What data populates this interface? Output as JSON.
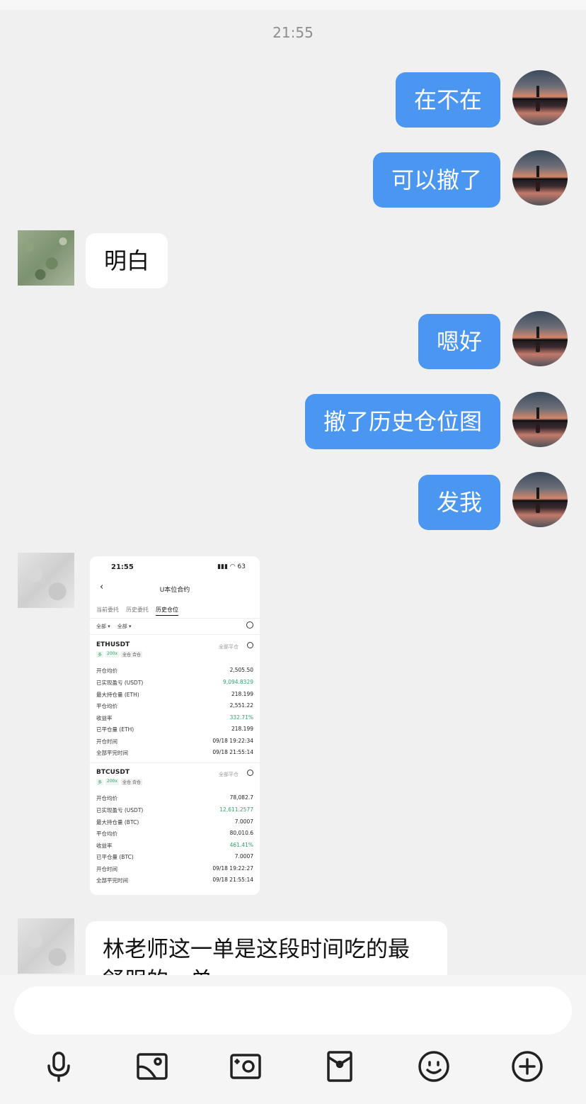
{
  "timestamp": "21:55",
  "messages": {
    "m1": "在不在",
    "m2": "可以撤了",
    "m3": "明白",
    "m4": "嗯好",
    "m5": "撤了历史仓位图",
    "m6": "发我",
    "m7_line1": "林老师这一单是这段时间吃的最",
    "m7_line2": "舒服的一单"
  },
  "screenshot": {
    "status_time": "21:55",
    "status_icons": "▮▮▮ ◠ 63",
    "title": "U本位合约",
    "tabs": [
      "当前委托",
      "历史委托",
      "历史仓位"
    ],
    "filters": [
      "全部 ▾",
      "全部 ▾"
    ],
    "positions": [
      {
        "symbol": "ETHUSDT",
        "status": "全部平仓",
        "tags": [
          "多",
          "200x",
          "全仓 合仓"
        ],
        "rows": [
          {
            "label": "开仓均价",
            "value": "2,505.50",
            "green": false
          },
          {
            "label": "已实现盈亏 (USDT)",
            "value": "9,094.8329",
            "green": true
          },
          {
            "label": "最大持仓量 (ETH)",
            "value": "218.199",
            "green": false
          },
          {
            "label": "平仓均价",
            "value": "2,551.22",
            "green": false
          },
          {
            "label": "收益率",
            "value": "332.71%",
            "green": true
          },
          {
            "label": "已平仓量 (ETH)",
            "value": "218.199",
            "green": false
          },
          {
            "label": "开仓时间",
            "value": "09/18 19:22:34",
            "green": false
          },
          {
            "label": "全部平完时间",
            "value": "09/18 21:55:14",
            "green": false
          }
        ]
      },
      {
        "symbol": "BTCUSDT",
        "status": "全部平仓",
        "tags": [
          "多",
          "200x",
          "全仓 合仓"
        ],
        "rows": [
          {
            "label": "开仓均价",
            "value": "78,082.7",
            "green": false
          },
          {
            "label": "已实现盈亏 (USDT)",
            "value": "12,611.2577",
            "green": true
          },
          {
            "label": "最大持仓量 (BTC)",
            "value": "7.0007",
            "green": false
          },
          {
            "label": "平仓均价",
            "value": "80,010.6",
            "green": false
          },
          {
            "label": "收益率",
            "value": "461.41%",
            "green": true
          },
          {
            "label": "已平仓量 (BTC)",
            "value": "7.0007",
            "green": false
          },
          {
            "label": "开仓时间",
            "value": "09/18 19:22:27",
            "green": false
          },
          {
            "label": "全部平完时间",
            "value": "09/18 21:55:14",
            "green": false
          }
        ]
      }
    ]
  },
  "toolbar": {
    "icons": [
      "microphone-icon",
      "photo-icon",
      "camera-icon",
      "red-packet-icon",
      "emoji-icon",
      "plus-icon"
    ]
  }
}
